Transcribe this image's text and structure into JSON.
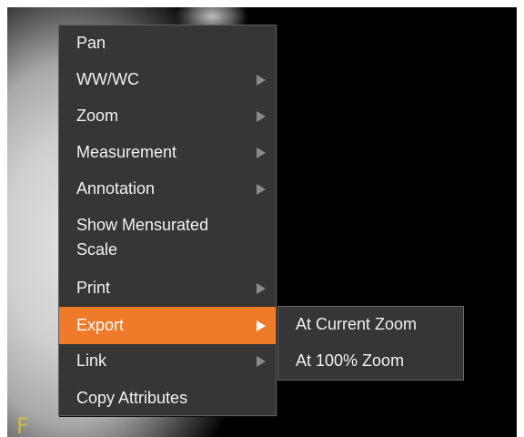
{
  "overlay": {
    "orientation_marker": "F"
  },
  "context_menu": {
    "items": [
      {
        "label": "Pan",
        "has_submenu": false
      },
      {
        "label": "WW/WC",
        "has_submenu": true
      },
      {
        "label": "Zoom",
        "has_submenu": true
      },
      {
        "label": "Measurement",
        "has_submenu": true
      },
      {
        "label": "Annotation",
        "has_submenu": true
      },
      {
        "label": "Show Mensurated Scale",
        "label_line1": "Show Mensurated",
        "label_line2": "Scale",
        "has_submenu": false
      },
      {
        "label": "Print",
        "has_submenu": true
      },
      {
        "label": "Export",
        "has_submenu": true,
        "active": true
      },
      {
        "label": "Link",
        "has_submenu": true
      },
      {
        "label": "Copy Attributes",
        "has_submenu": false
      }
    ]
  },
  "export_submenu": {
    "items": [
      {
        "label": "At Current Zoom"
      },
      {
        "label": "At 100% Zoom"
      }
    ]
  },
  "colors": {
    "menu_bg": "#363636",
    "highlight": "#ef7a2a",
    "text": "#f2f2f2",
    "submenu_arrow": "#8a8a8a"
  }
}
